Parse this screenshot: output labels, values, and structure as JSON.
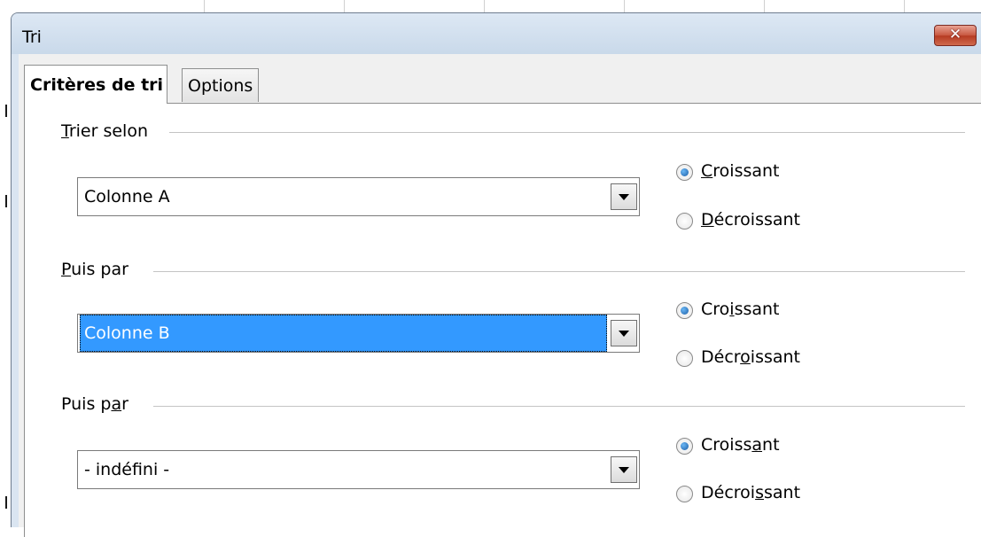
{
  "window": {
    "title": "Tri",
    "close_glyph": "✕"
  },
  "tabs": [
    {
      "label": "Critères de tri",
      "active": true
    },
    {
      "label": "Options",
      "active": false
    }
  ],
  "groups": [
    {
      "label_pre": "",
      "label_key": "T",
      "label_post": "rier selon",
      "combo_value": "Colonne A",
      "combo_selected": false,
      "options": [
        {
          "pre": "",
          "key": "C",
          "post": "roissant",
          "checked": true
        },
        {
          "pre": "",
          "key": "D",
          "post": "écroissant",
          "checked": false
        }
      ]
    },
    {
      "label_pre": "",
      "label_key": "P",
      "label_post": "uis par",
      "combo_value": "Colonne B",
      "combo_selected": true,
      "options": [
        {
          "pre": "Cro",
          "key": "i",
          "post": "ssant",
          "checked": true
        },
        {
          "pre": "Décr",
          "key": "o",
          "post": "issant",
          "checked": false
        }
      ]
    },
    {
      "label_pre": "Puis p",
      "label_key": "a",
      "label_post": "r",
      "combo_value": "- indéfini -",
      "combo_selected": false,
      "options": [
        {
          "pre": "Croiss",
          "key": "a",
          "post": "nt",
          "checked": true
        },
        {
          "pre": "Décroi",
          "key": "s",
          "post": "sant",
          "checked": false
        }
      ]
    }
  ],
  "icons": {
    "close": "close-icon",
    "dropdown": "chevron-down-icon"
  },
  "colors": {
    "selection": "#3399ff",
    "titlebar": "#c9d9ea",
    "close_button": "#c7573f"
  }
}
